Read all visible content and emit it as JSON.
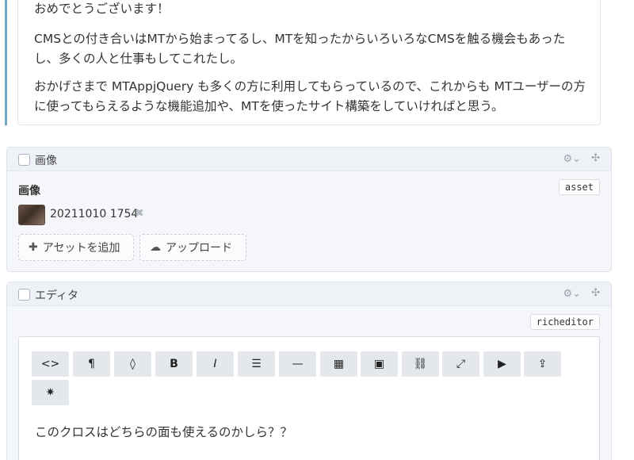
{
  "text_block": {
    "p1": "おめでとうございます！",
    "p2": "CMSとの付き合いはMTから始まってるし、MTを知ったからいろいろなCMSを触る機会もあったし、多くの人と仕事もしてこれたし。",
    "p3": "おかげさまで MTAppjQuery も多くの方に利用してもらっているので、これからも MTユーザーの方に使ってもらえるような機能追加や、MTを使ったサイト構築をしていければと思う。"
  },
  "image_block": {
    "title": "画像",
    "field_label": "画像",
    "badge": "asset",
    "asset_name": "20211010 1754",
    "add_asset_label": "アセットを追加",
    "upload_label": "アップロード"
  },
  "editor_block": {
    "title": "エディタ",
    "badge": "richeditor",
    "content": "このクロスはどちらの面も使えるのかしら？？",
    "toolbar": [
      "code-icon",
      "paragraph-icon",
      "color-drop-icon",
      "bold-icon",
      "italic-icon",
      "list-icon",
      "horizontal-rule-icon",
      "table-icon",
      "image-icon",
      "link-icon",
      "fullscreen-icon",
      "video-icon",
      "upload-icon",
      "settings-icon"
    ]
  },
  "colors": {
    "accent_line": "#6fa8c9",
    "block_bg": "#f4f6f9",
    "toolbar_button": "#e4e8ec"
  }
}
